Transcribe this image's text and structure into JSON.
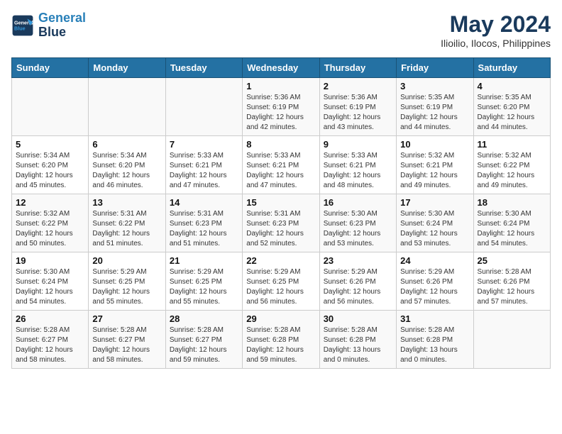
{
  "header": {
    "logo_line1": "General",
    "logo_line2": "Blue",
    "title": "May 2024",
    "subtitle": "Ilioilio, Ilocos, Philippines"
  },
  "calendar": {
    "weekdays": [
      "Sunday",
      "Monday",
      "Tuesday",
      "Wednesday",
      "Thursday",
      "Friday",
      "Saturday"
    ],
    "weeks": [
      [
        {
          "day": "",
          "info": ""
        },
        {
          "day": "",
          "info": ""
        },
        {
          "day": "",
          "info": ""
        },
        {
          "day": "1",
          "info": "Sunrise: 5:36 AM\nSunset: 6:19 PM\nDaylight: 12 hours\nand 42 minutes."
        },
        {
          "day": "2",
          "info": "Sunrise: 5:36 AM\nSunset: 6:19 PM\nDaylight: 12 hours\nand 43 minutes."
        },
        {
          "day": "3",
          "info": "Sunrise: 5:35 AM\nSunset: 6:19 PM\nDaylight: 12 hours\nand 44 minutes."
        },
        {
          "day": "4",
          "info": "Sunrise: 5:35 AM\nSunset: 6:20 PM\nDaylight: 12 hours\nand 44 minutes."
        }
      ],
      [
        {
          "day": "5",
          "info": "Sunrise: 5:34 AM\nSunset: 6:20 PM\nDaylight: 12 hours\nand 45 minutes."
        },
        {
          "day": "6",
          "info": "Sunrise: 5:34 AM\nSunset: 6:20 PM\nDaylight: 12 hours\nand 46 minutes."
        },
        {
          "day": "7",
          "info": "Sunrise: 5:33 AM\nSunset: 6:21 PM\nDaylight: 12 hours\nand 47 minutes."
        },
        {
          "day": "8",
          "info": "Sunrise: 5:33 AM\nSunset: 6:21 PM\nDaylight: 12 hours\nand 47 minutes."
        },
        {
          "day": "9",
          "info": "Sunrise: 5:33 AM\nSunset: 6:21 PM\nDaylight: 12 hours\nand 48 minutes."
        },
        {
          "day": "10",
          "info": "Sunrise: 5:32 AM\nSunset: 6:21 PM\nDaylight: 12 hours\nand 49 minutes."
        },
        {
          "day": "11",
          "info": "Sunrise: 5:32 AM\nSunset: 6:22 PM\nDaylight: 12 hours\nand 49 minutes."
        }
      ],
      [
        {
          "day": "12",
          "info": "Sunrise: 5:32 AM\nSunset: 6:22 PM\nDaylight: 12 hours\nand 50 minutes."
        },
        {
          "day": "13",
          "info": "Sunrise: 5:31 AM\nSunset: 6:22 PM\nDaylight: 12 hours\nand 51 minutes."
        },
        {
          "day": "14",
          "info": "Sunrise: 5:31 AM\nSunset: 6:23 PM\nDaylight: 12 hours\nand 51 minutes."
        },
        {
          "day": "15",
          "info": "Sunrise: 5:31 AM\nSunset: 6:23 PM\nDaylight: 12 hours\nand 52 minutes."
        },
        {
          "day": "16",
          "info": "Sunrise: 5:30 AM\nSunset: 6:23 PM\nDaylight: 12 hours\nand 53 minutes."
        },
        {
          "day": "17",
          "info": "Sunrise: 5:30 AM\nSunset: 6:24 PM\nDaylight: 12 hours\nand 53 minutes."
        },
        {
          "day": "18",
          "info": "Sunrise: 5:30 AM\nSunset: 6:24 PM\nDaylight: 12 hours\nand 54 minutes."
        }
      ],
      [
        {
          "day": "19",
          "info": "Sunrise: 5:30 AM\nSunset: 6:24 PM\nDaylight: 12 hours\nand 54 minutes."
        },
        {
          "day": "20",
          "info": "Sunrise: 5:29 AM\nSunset: 6:25 PM\nDaylight: 12 hours\nand 55 minutes."
        },
        {
          "day": "21",
          "info": "Sunrise: 5:29 AM\nSunset: 6:25 PM\nDaylight: 12 hours\nand 55 minutes."
        },
        {
          "day": "22",
          "info": "Sunrise: 5:29 AM\nSunset: 6:25 PM\nDaylight: 12 hours\nand 56 minutes."
        },
        {
          "day": "23",
          "info": "Sunrise: 5:29 AM\nSunset: 6:26 PM\nDaylight: 12 hours\nand 56 minutes."
        },
        {
          "day": "24",
          "info": "Sunrise: 5:29 AM\nSunset: 6:26 PM\nDaylight: 12 hours\nand 57 minutes."
        },
        {
          "day": "25",
          "info": "Sunrise: 5:28 AM\nSunset: 6:26 PM\nDaylight: 12 hours\nand 57 minutes."
        }
      ],
      [
        {
          "day": "26",
          "info": "Sunrise: 5:28 AM\nSunset: 6:27 PM\nDaylight: 12 hours\nand 58 minutes."
        },
        {
          "day": "27",
          "info": "Sunrise: 5:28 AM\nSunset: 6:27 PM\nDaylight: 12 hours\nand 58 minutes."
        },
        {
          "day": "28",
          "info": "Sunrise: 5:28 AM\nSunset: 6:27 PM\nDaylight: 12 hours\nand 59 minutes."
        },
        {
          "day": "29",
          "info": "Sunrise: 5:28 AM\nSunset: 6:28 PM\nDaylight: 12 hours\nand 59 minutes."
        },
        {
          "day": "30",
          "info": "Sunrise: 5:28 AM\nSunset: 6:28 PM\nDaylight: 13 hours\nand 0 minutes."
        },
        {
          "day": "31",
          "info": "Sunrise: 5:28 AM\nSunset: 6:28 PM\nDaylight: 13 hours\nand 0 minutes."
        },
        {
          "day": "",
          "info": ""
        }
      ]
    ]
  }
}
